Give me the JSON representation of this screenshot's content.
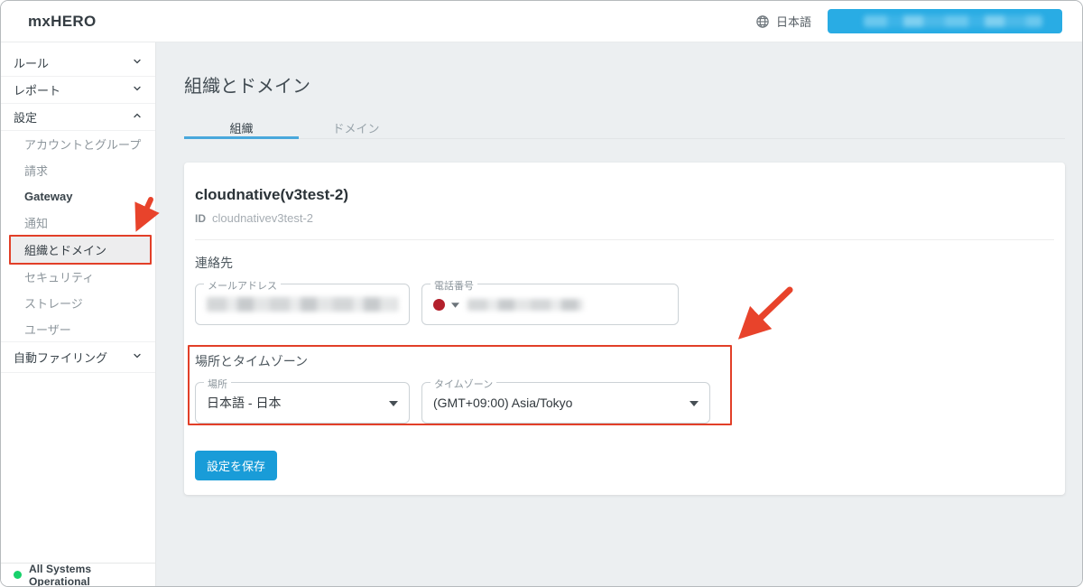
{
  "header": {
    "logo": "mxHERO",
    "language_label": "日本語"
  },
  "sidebar": {
    "items": [
      {
        "label": "ルール"
      },
      {
        "label": "レポート"
      },
      {
        "label": "設定"
      },
      {
        "label": "アカウントとグループ"
      },
      {
        "label": "請求"
      },
      {
        "label": "Gateway"
      },
      {
        "label": "通知"
      },
      {
        "label": "組織とドメイン"
      },
      {
        "label": "セキュリティ"
      },
      {
        "label": "ストレージ"
      },
      {
        "label": "ユーザー"
      },
      {
        "label": "自動ファイリング"
      }
    ],
    "status_label": "All Systems Operational"
  },
  "page": {
    "title": "組織とドメイン"
  },
  "tabs": {
    "organization": "組織",
    "domain": "ドメイン"
  },
  "organization": {
    "name": "cloudnative(v3test-2)",
    "id_label": "ID",
    "id_value": "cloudnativev3test-2",
    "contact": {
      "heading": "連絡先",
      "email_label": "メールアドレス",
      "phone_label": "電話番号"
    },
    "location": {
      "heading": "場所とタイムゾーン",
      "location_label": "場所",
      "location_value": "日本語 - 日本",
      "timezone_label": "タイムゾーン",
      "timezone_value": "(GMT+09:00) Asia/Tokyo"
    },
    "save_label": "設定を保存"
  },
  "colors": {
    "accent_blue": "#29ace4",
    "save_button_blue": "#199cd8",
    "tab_underline_blue": "#49a8dc",
    "annotation_red": "#e23f28",
    "status_green": "#17d16b",
    "flag_red": "#b3202c"
  }
}
